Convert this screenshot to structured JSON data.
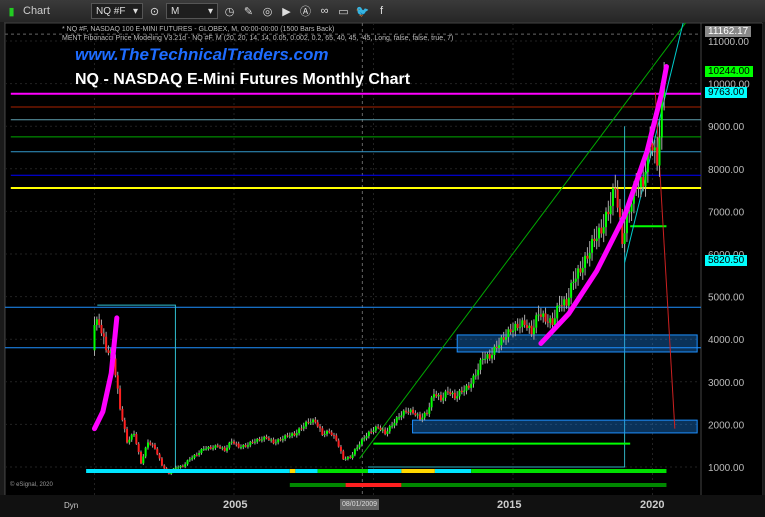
{
  "toolbar": {
    "app_label": "Chart",
    "symbol": "NQ #F",
    "interval": "M",
    "icons": [
      "link-icon",
      "symbol-settings-icon",
      "clock-icon",
      "pencil-icon",
      "indicator-icon",
      "play-icon",
      "alert-icon",
      "chain-link-icon",
      "chat-icon",
      "twitter-icon",
      "facebook-icon"
    ]
  },
  "info_line_1": "* NQ #F, NASDAQ 100 E-MINI FUTURES - GLOBEX, M, 00:00-00:00 (1500 Bars Back)",
  "info_line_2": "MENT Fibonacci Price Modeling V3.21d - NQ #F, M (20, 20, 14, 14, 0.05, 0.002, 0.2, 65, 40, 45, -45, Long, false, false, true, 7)",
  "website": "www.TheTechnicalTraders.com",
  "copyright": "© eSignal, 2020",
  "dyn_label": "Dyn",
  "crosshair_date": "08/01/2009",
  "price_labels": {
    "top": "11162.17",
    "high": "10244.00",
    "level": "9763.00",
    "low": "5820.50"
  },
  "colors": {
    "up": "#00ff00",
    "down": "#ff2020",
    "magenta": "#ff00ff",
    "cyan": "#00ffff",
    "yellow": "#ffff00",
    "blue": "#0000ff"
  },
  "chart_data": {
    "type": "candlestick",
    "title": "NQ - NASDAQ E-Mini Futures Monthly Chart",
    "ylim": [
      700,
      11300
    ],
    "xlim": [
      1997,
      2021.8
    ],
    "y_ticks": [
      "1000.00",
      "2000.00",
      "3000.00",
      "4000.00",
      "5000.00",
      "6000.00",
      "7000.00",
      "8000.00",
      "9000.00",
      "10000.00",
      "11000.00"
    ],
    "x_ticks": [
      "2005",
      "2015",
      "2020"
    ],
    "quarterly_close": {
      "start": 2000,
      "values": [
        4400,
        3800,
        3600,
        2400,
        1600,
        1800,
        1100,
        1600,
        1450,
        1050,
        850,
        1000,
        1020,
        1200,
        1300,
        1450,
        1450,
        1500,
        1400,
        1620,
        1480,
        1500,
        1600,
        1650,
        1700,
        1580,
        1650,
        1750,
        1770,
        1930,
        2080,
        2080,
        1780,
        1840,
        1650,
        1200,
        1230,
        1480,
        1700,
        1850,
        1950,
        1800,
        2000,
        2200,
        2330,
        2300,
        2150,
        2280,
        2750,
        2600,
        2800,
        2650,
        2800,
        2900,
        3200,
        3590,
        3600,
        3850,
        4050,
        4230,
        4330,
        4400,
        4180,
        4650,
        4480,
        4400,
        4870,
        4860,
        5430,
        5650,
        5980,
        6400,
        6580,
        7040,
        7630,
        6330,
        7100,
        7670,
        7700,
        8730,
        8200,
        10200
      ]
    },
    "levels": [
      {
        "price": 9763,
        "color": "#ff00ff"
      },
      {
        "price": 9450,
        "color": "#aa2200"
      },
      {
        "price": 9150,
        "color": "#5fa0b0"
      },
      {
        "price": 8750,
        "color": "#00aa00"
      },
      {
        "price": 8400,
        "color": "#3399cc"
      },
      {
        "price": 7850,
        "color": "#0000ff"
      },
      {
        "price": 7550,
        "color": "#ffff00"
      },
      {
        "price": 4750,
        "color": "#1e90ff"
      },
      {
        "price": 3800,
        "color": "#1e90ff"
      }
    ],
    "magenta_curves": [
      [
        [
          2000.0,
          1900
        ],
        [
          2000.3,
          2300
        ],
        [
          2000.6,
          3200
        ],
        [
          2000.8,
          4500
        ]
      ],
      [
        [
          2016.0,
          3900
        ],
        [
          2017.0,
          4600
        ],
        [
          2018.0,
          5600
        ],
        [
          2019.0,
          6900
        ],
        [
          2019.8,
          8400
        ],
        [
          2020.3,
          9700
        ],
        [
          2020.5,
          10400
        ]
      ]
    ],
    "trend_bars": [
      {
        "row": 1,
        "segments": [
          [
            1999.7,
            2007.0,
            "#00e5ff"
          ],
          [
            2007.0,
            2007.2,
            "#ffd700"
          ],
          [
            2007.2,
            2008.0,
            "#00e5ff"
          ],
          [
            2008.0,
            2009.8,
            "#00e000"
          ],
          [
            2009.8,
            2011.0,
            "#00e5ff"
          ],
          [
            2011.0,
            2012.2,
            "#ffd700"
          ],
          [
            2012.2,
            2013.5,
            "#00e5ff"
          ],
          [
            2013.5,
            2020.5,
            "#00e000"
          ]
        ]
      },
      {
        "row": 2,
        "segments": [
          [
            2007.0,
            2009.0,
            "#008800"
          ],
          [
            2009.0,
            2011.0,
            "#ff2020"
          ],
          [
            2011.0,
            2020.5,
            "#008800"
          ]
        ]
      }
    ]
  }
}
